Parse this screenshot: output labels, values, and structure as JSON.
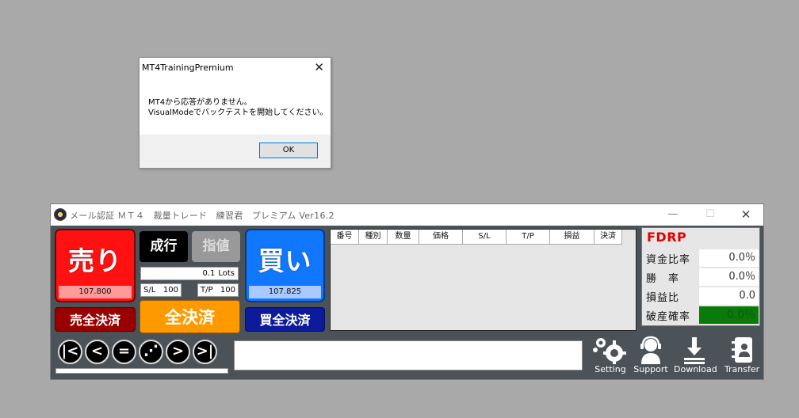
{
  "dialog": {
    "title": "MT4TrainingPremium",
    "close": "✕",
    "message_line1": "MT4から応答がありません。",
    "message_line2": "VisualModeでバックテストを開始してください。",
    "ok": "OK"
  },
  "window": {
    "title": "メール認証 ＭＴ４　裁量トレード　練習君　プレミアム Ver16.2",
    "min": "—",
    "max": "☐",
    "close": "✕"
  },
  "trade": {
    "sell_label": "売り",
    "sell_price": "107.800",
    "buy_label": "買い",
    "buy_price": "107.825",
    "market_label": "成行",
    "limit_label": "指値",
    "lots_value": "0.1",
    "lots_unit": "Lots",
    "sl_label": "S/L",
    "sl_value": "100",
    "tp_label": "T/P",
    "tp_value": "100",
    "close_sell": "売全決済",
    "close_all": "全決済",
    "close_buy": "買全決済"
  },
  "table": {
    "columns": [
      "番号",
      "種別",
      "数量",
      "価格",
      "S/L",
      "T/P",
      "損益",
      "決済"
    ]
  },
  "nav": {
    "first": "|<",
    "prev": "<",
    "pause": "=",
    "step": "⋰",
    "next": ">",
    "last": ">|",
    "progress": 0
  },
  "tools": {
    "setting": "Setting",
    "support": "Support",
    "download": "Download",
    "transfer": "Transfer"
  },
  "stats": {
    "title": "FDRP",
    "rows": [
      {
        "label": "資金比率",
        "value": "0.0％"
      },
      {
        "label": "勝　率",
        "value": "0.0％"
      },
      {
        "label": "損益比",
        "value": "0.0"
      },
      {
        "label": "破産確率",
        "value": "0.0％"
      }
    ]
  },
  "colors": {
    "sell": "#ff1111",
    "buy": "#1177ff",
    "close_all": "#ff9900",
    "fdrp": "#e30000",
    "risk_ok": "#0a7a0a"
  }
}
